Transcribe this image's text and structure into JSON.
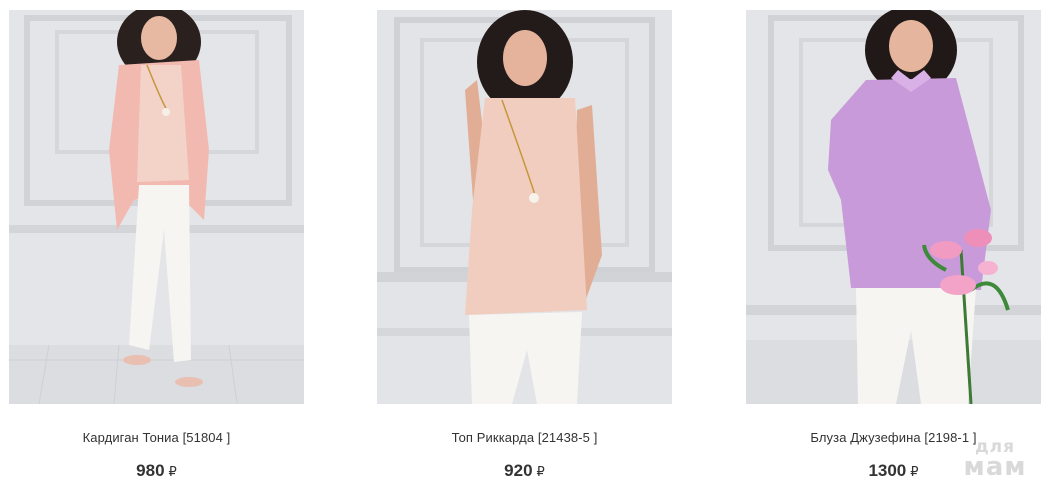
{
  "products": [
    {
      "name": "Кардиган Тониа [51804 ]",
      "price": "980",
      "currency": "₽",
      "colors": {
        "garment": "#f2b9b0",
        "top": "#f3d2c7"
      }
    },
    {
      "name": "Топ Риккарда [21438-5 ]",
      "price": "920",
      "currency": "₽",
      "colors": {
        "garment": "#f1cdbf"
      }
    },
    {
      "name": "Блуза Джузефина [2198-1 ]",
      "price": "1300",
      "currency": "₽",
      "colors": {
        "garment": "#c89ad9"
      }
    }
  ],
  "watermark": {
    "line1": "для",
    "line2": "мам"
  }
}
